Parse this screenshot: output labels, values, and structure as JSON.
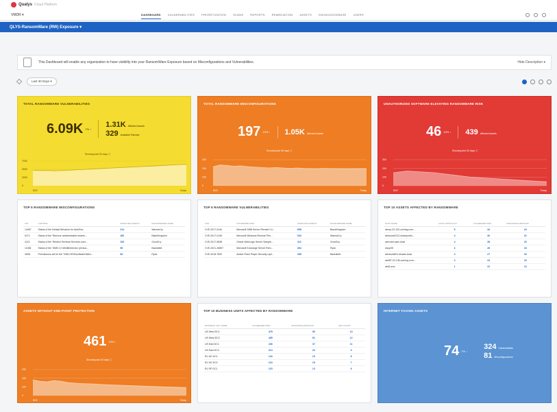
{
  "app": {
    "brand": "Qualys",
    "brand_sub": "Cloud Platform",
    "module": "VMDR ▾"
  },
  "nav": {
    "tabs": [
      "DASHBOARD",
      "VULNERABILITIES",
      "PRIORITIZATION",
      "SCANS",
      "REPORTS",
      "REMEDIATION",
      "ASSETS",
      "KNOWLEDGEBASE",
      "USERS"
    ],
    "active": 0
  },
  "dashboard": {
    "title": "QLYS-RansomWare (RW) Exposure ▾",
    "description": "This Dashboard will enable any organization to have visibility into your RansomWare Exposure based on Misconfigurations and Vulnerabilities.",
    "hide_description": "Hide Description ▾",
    "date_filter": "Last 30 Days ▾"
  },
  "cards": {
    "rw_vulns": {
      "title": "Total Ransomware Vulnerabilities",
      "value": "6.09K",
      "delta": "7% ↑",
      "affected_assets": "1.31K",
      "affected_label": "Affected Assets",
      "patches": "329",
      "patches_label": "Available Patches",
      "showing": "Showing last 30 days ⓘ",
      "x_start": "8/22",
      "x_end": "Today",
      "y_ticks": [
        "7000",
        "5000",
        "3000",
        "0"
      ]
    },
    "rw_misconfig": {
      "title": "Total Ransomware Misconfigurations",
      "value": "197",
      "delta": "19% ↓",
      "affected_assets": "1.05K",
      "affected_label": "Affected Assets",
      "showing": "Showing last 30 days ⓘ",
      "x_start": "8/22",
      "x_end": "Today",
      "y_ticks": [
        "300",
        "200",
        "100",
        "0"
      ]
    },
    "unauth_sw": {
      "title": "Unauthorized Software Elevating Ransomware Risk",
      "value": "46",
      "delta": "10% ↓",
      "affected_assets": "439",
      "affected_label": "Affected Assets",
      "showing": "Showing last 30 days ⓘ",
      "x_start": "8/22",
      "x_end": "Today",
      "y_ticks": [
        "300",
        "200",
        "100",
        "0"
      ]
    },
    "top_misconfig": {
      "title": "Top 5 Ransomware Misconfigurations",
      "columns": [
        "CID",
        "Control",
        "Affected Assets",
        "Ransomware Name"
      ],
      "rows": [
        [
          "14467",
          "Status of the Default Behavior for AutoRun",
          "214",
          "WannaCry"
        ],
        [
          "5171",
          "Status of the 'Remove administrative shares...",
          "180",
          "BlackKingdom"
        ],
        [
          "4121",
          "Status of the 'Restrict Terminal Services user...",
          "153",
          "GoodCry"
        ],
        [
          "11384",
          "Status of the 'SMB 2.0 Minifiledirector (versus...",
          "98",
          "Badrabbit"
        ],
        [
          "4838",
          "Permissions set for the '%WLOS%\\\\software\\\\Micr...",
          "83",
          "Ryuk"
        ]
      ]
    },
    "top_vulns": {
      "title": "Top 5 Ransomware Vulnerabilities",
      "columns": [
        "CVE",
        "Vulnerabilities",
        "Affected Assets",
        "Ransomware Name"
      ],
      "rows": [
        [
          "CVE-2017-0144",
          "Microsoft SMB Server Remote Co...",
          "658",
          "BlackKingdom"
        ],
        [
          "CVE-2017-0145",
          "Microsoft Windows Remote Prin...",
          "543",
          "WannaCry"
        ],
        [
          "CVE-2017-5638",
          "Oracle WebLogic Server Sample...",
          "412",
          "GoodCry"
        ],
        [
          "CVE-2021-26857",
          "Microsoft Exchange Server Rem...",
          "364",
          "Ryuk"
        ],
        [
          "CVE-2018-7600",
          "Adobe Flash Player Security Upd...",
          "268",
          "Badrabbit"
        ]
      ]
    },
    "top_assets": {
      "title": "Top 10 Assets Affected by Ransomware",
      "columns": [
        "Host Name",
        "Host Criticality",
        "Vulnerabilities",
        "Misconfigurations"
      ],
      "rows": [
        [
          "winsp-22-120.corning.com...",
          "5",
          "34",
          "24"
        ],
        [
          "windows2012.sharepoint.l...",
          "4",
          "30",
          "22"
        ],
        [
          "winrvdev.qlsn.local",
          "4",
          "28",
          "20"
        ],
        [
          "wsop05",
          "4",
          "26",
          "18"
        ],
        [
          "windows801.disacis.local",
          "3",
          "27",
          "16"
        ],
        [
          "win8P-22-136.corning.com...",
          "3",
          "24",
          "15"
        ],
        [
          "win8-scsi",
          "1",
          "22",
          "13"
        ]
      ]
    },
    "no_epp": {
      "title": "Assets Without End-Point Protection",
      "value": "461",
      "delta": "10% ↓",
      "showing": "Showing last 30 days ⓘ",
      "x_start": "8/22",
      "x_end": "Today",
      "y_ticks": [
        "200",
        "150",
        "100",
        "0"
      ]
    },
    "top_bu": {
      "title": "Top 10 Business Units Affected by Ransomware",
      "columns": [
        "Business Unit Name",
        "Vulnerabilities",
        "Misconfigurations",
        "EPP Count"
      ],
      "rows": [
        [
          "US West DC1",
          "478",
          "59",
          "13"
        ],
        [
          "US West DC2",
          "455",
          "51",
          "12"
        ],
        [
          "US East DC1",
          "246",
          "37",
          "11"
        ],
        [
          "US East DC2",
          "214",
          "23",
          "9"
        ],
        [
          "EU UK DC1",
          "143",
          "19",
          "8"
        ],
        [
          "EU UK DC2",
          "124",
          "15",
          "7"
        ],
        [
          "EU SP DC1",
          "123",
          "13",
          "6"
        ]
      ]
    },
    "internet_facing": {
      "title": "Internet Facing Assets",
      "value": "74",
      "delta": "7% ↑",
      "vulns": "324",
      "vulns_label": "Vulnerabilities",
      "misconfig": "81",
      "misconfig_label": "Misconfigurations"
    }
  },
  "colors": {
    "accent": "#1e63c4",
    "yellow": "#f5dc30",
    "orange": "#ee7d24",
    "red": "#e23a35",
    "blue": "#5b93d3"
  },
  "chart_data": [
    {
      "type": "area",
      "title": "Total Ransomware Vulnerabilities",
      "x": [
        "8/22",
        "Today"
      ],
      "ylim": [
        0,
        7000
      ],
      "values": [
        4400,
        4300,
        4350,
        4250,
        4300,
        4400,
        4500,
        4600,
        4700,
        4800,
        4900,
        5000,
        5100,
        5200,
        5300,
        5400,
        5500,
        5600,
        5700,
        5800,
        5900,
        6000,
        6090
      ]
    },
    {
      "type": "area",
      "title": "Total Ransomware Misconfigurations",
      "x": [
        "8/22",
        "Today"
      ],
      "ylim": [
        0,
        300
      ],
      "values": [
        220,
        240,
        235,
        225,
        230,
        220,
        215,
        210,
        205,
        210,
        205,
        200,
        205,
        200,
        198,
        197,
        200,
        198,
        197,
        196,
        197,
        198,
        197
      ]
    },
    {
      "type": "area",
      "title": "Unauthorized Software Elevating Ransomware Risk",
      "x": [
        "8/22",
        "Today"
      ],
      "ylim": [
        0,
        300
      ],
      "values": [
        150,
        160,
        170,
        165,
        160,
        155,
        150,
        140,
        130,
        120,
        110,
        100,
        95,
        90,
        85,
        80,
        75,
        70,
        65,
        60,
        55,
        50,
        46
      ]
    },
    {
      "type": "area",
      "title": "Assets Without End-Point Protection",
      "x": [
        "8/22",
        "Today"
      ],
      "ylim": [
        0,
        200
      ],
      "values": [
        120,
        110,
        105,
        115,
        110,
        100,
        95,
        92,
        90,
        88,
        85,
        82,
        80,
        78,
        76,
        74,
        72,
        70,
        68,
        66,
        64,
        62,
        60
      ]
    }
  ]
}
